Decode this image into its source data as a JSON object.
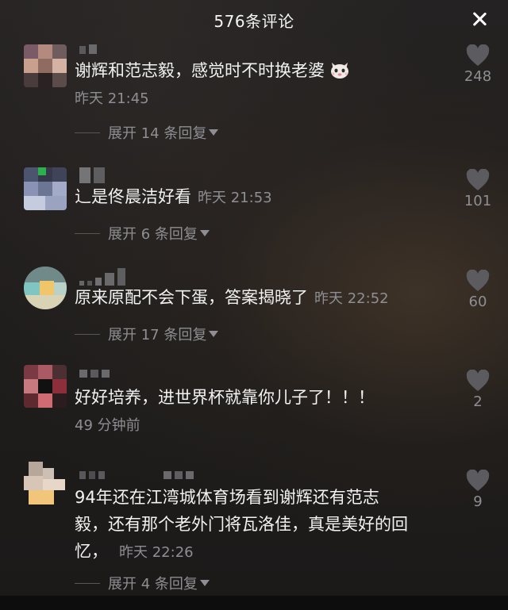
{
  "header": {
    "title": "576条评论"
  },
  "comments": [
    {
      "text": "谢辉和范志毅，感觉时不时换老婆",
      "time": "昨天 21:45",
      "expand": "展开 14 条回复",
      "likes": "248"
    },
    {
      "text": "辶是佟晨洁好看",
      "time": "昨天 21:53",
      "expand": "展开 6 条回复",
      "likes": "101"
    },
    {
      "text": "原来原配不会下蛋，答案揭晓了",
      "time": "昨天 22:52",
      "expand": "展开 17 条回复",
      "likes": "60"
    },
    {
      "text": "好好培养，进世界杯就靠你儿子了！！！",
      "time": "49 分钟前",
      "likes": "2"
    },
    {
      "text_line1": "94年还在江湾城体育场看到谢辉还有范志",
      "text_line2": "毅，还有那个老外门将瓦洛佳，真是美好的回",
      "text_line3": "忆，",
      "time": "昨天 22:26",
      "expand": "展开 4 条回复",
      "likes": "9"
    }
  ],
  "icons": {
    "close": "close-icon",
    "like": "heart-icon",
    "emoji": "cat-emoji-icon"
  }
}
